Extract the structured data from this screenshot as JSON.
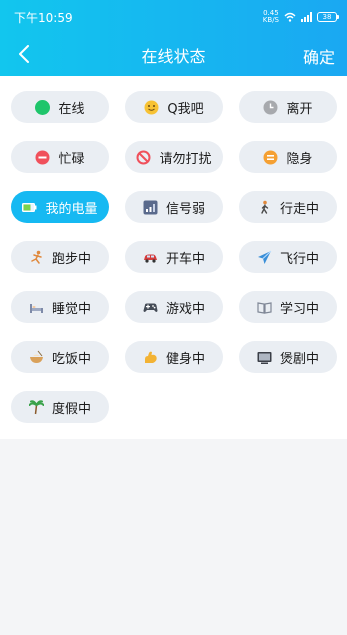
{
  "status_bar": {
    "time": "下午10:59",
    "net_speed_value": "0.45",
    "net_speed_unit": "KB/S",
    "battery": "38"
  },
  "nav": {
    "title": "在线状态",
    "confirm": "确定"
  },
  "statuses": [
    {
      "label": "在线",
      "icon": "green-dot-icon",
      "color": "#1fc56b"
    },
    {
      "label": "Q我吧",
      "icon": "smile-face-icon",
      "color": "#f7c234"
    },
    {
      "label": "离开",
      "icon": "clock-icon",
      "color": "#a7a9ad"
    },
    {
      "label": "忙碌",
      "icon": "minus-circle-icon",
      "color": "#f0505b"
    },
    {
      "label": "请勿打扰",
      "icon": "do-not-disturb-icon",
      "color": "#f0505b"
    },
    {
      "label": "隐身",
      "icon": "equals-circle-icon",
      "color": "#f5a032"
    },
    {
      "label": "我的电量",
      "icon": "battery-icon",
      "color": "#7bd34b",
      "active": true
    },
    {
      "label": "信号弱",
      "icon": "signal-icon",
      "color": "#5a6a8c"
    },
    {
      "label": "行走中",
      "icon": "walking-icon",
      "color": "#e0893d"
    },
    {
      "label": "跑步中",
      "icon": "running-icon",
      "color": "#e0893d"
    },
    {
      "label": "开车中",
      "icon": "car-icon",
      "color": "#d43b3b"
    },
    {
      "label": "飞行中",
      "icon": "airplane-icon",
      "color": "#3a8fd8"
    },
    {
      "label": "睡觉中",
      "icon": "bed-icon",
      "color": "#7e8aa8"
    },
    {
      "label": "游戏中",
      "icon": "gamepad-icon",
      "color": "#444b56"
    },
    {
      "label": "学习中",
      "icon": "book-icon",
      "color": "#7f8796"
    },
    {
      "label": "吃饭中",
      "icon": "bowl-icon",
      "color": "#d9a15a"
    },
    {
      "label": "健身中",
      "icon": "muscle-icon",
      "color": "#f3b334"
    },
    {
      "label": "煲剧中",
      "icon": "tv-icon",
      "color": "#3b3f47"
    },
    {
      "label": "度假中",
      "icon": "palm-tree-icon",
      "color": "#3aa24a"
    }
  ]
}
